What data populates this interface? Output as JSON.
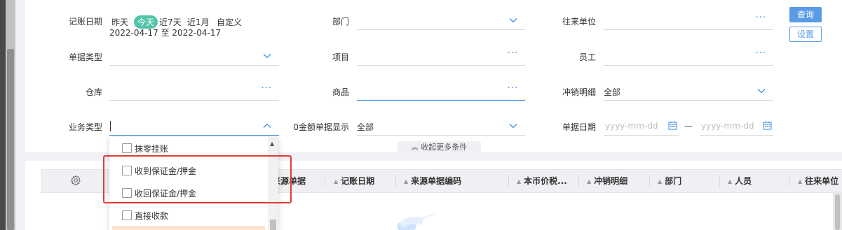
{
  "filters": {
    "date_label": "记账日期",
    "quick_dates": [
      "昨天",
      "今天",
      "近7天",
      "近1月",
      "自定义"
    ],
    "date_range_text": "2022-04-17 至 2022-04-17",
    "department_label": "部门",
    "counterparty_label": "往来单位",
    "doc_type_label": "单据类型",
    "project_label": "项目",
    "employee_label": "员工",
    "warehouse_label": "仓库",
    "product_label": "商品",
    "writeoff_detail_label": "冲销明细",
    "writeoff_detail_value": "全部",
    "business_type_label": "业务类型",
    "zero_amount_label": "0金额单据显示",
    "zero_amount_value": "全部",
    "doc_date_label": "单据日期",
    "doc_date_start_placeholder": "yyyy-mm-dd",
    "doc_date_sep": "—",
    "doc_date_end_placeholder": "yyyy-mm-dd",
    "ellipsis": "···"
  },
  "buttons": {
    "query": "查询",
    "settings": "设置"
  },
  "collapse_label": "收起更多条件",
  "dropdown": {
    "items": [
      "抹零挂账",
      "收到保证金/押金",
      "收回保证金/押金",
      "直接收款"
    ]
  },
  "table": {
    "columns": [
      "来源单据",
      "记账日期",
      "来源单据编码",
      "本币价税...",
      "冲销明细",
      "部门",
      "人员",
      "往来单位"
    ]
  },
  "colors": {
    "accent": "#5a9be6",
    "active_chip": "#52c5a8",
    "highlight_box": "#e53935"
  }
}
